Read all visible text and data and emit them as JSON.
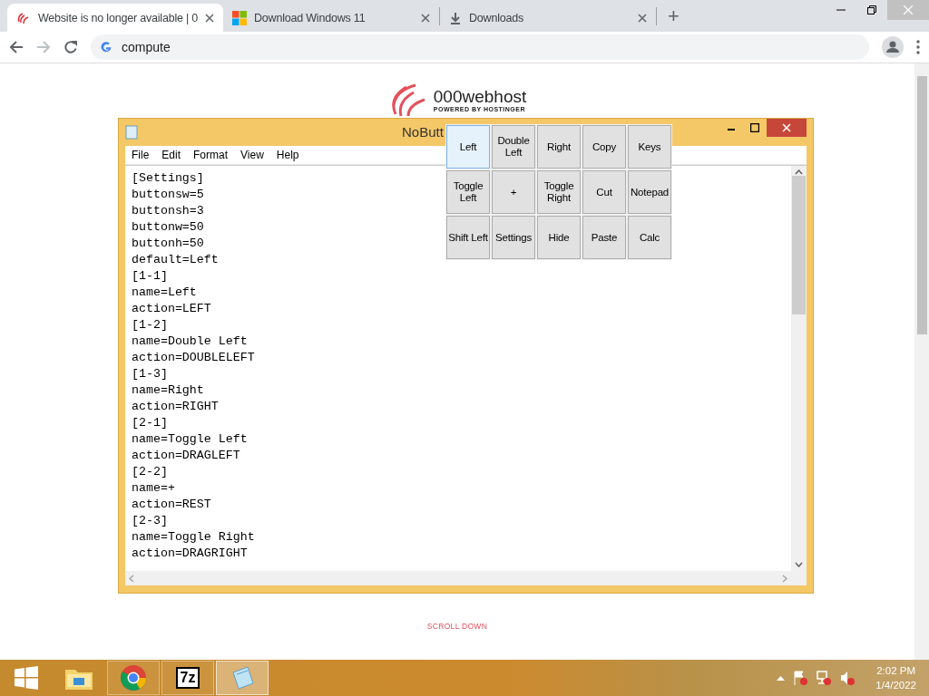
{
  "browser": {
    "tabs": [
      {
        "kind": "swirl",
        "title": "Website is no longer available | 0",
        "selected": true
      },
      {
        "kind": "windows",
        "title": "Download Windows 11",
        "selected": false
      },
      {
        "kind": "download",
        "title": "Downloads",
        "selected": false
      }
    ],
    "new_tab": "+",
    "address": "compute"
  },
  "page": {
    "logo_name": "000webhost",
    "logo_tagline": "POWERED BY HOSTINGER",
    "scroll_hint": "SCROLL DOWN"
  },
  "notepad": {
    "title": "NoButt",
    "menu": [
      "File",
      "Edit",
      "Format",
      "View",
      "Help"
    ],
    "lines": [
      "[Settings]",
      "buttonsw=5",
      "buttonsh=3",
      "buttonw=50",
      "buttonh=50",
      "default=Left",
      "[1-1]",
      "name=Left",
      "action=LEFT",
      "[1-2]",
      "name=Double Left",
      "action=DOUBLELEFT",
      "[1-3]",
      "name=Right",
      "action=RIGHT",
      "[2-1]",
      "name=Toggle Left",
      "action=DRAGLEFT",
      "[2-2]",
      "name=+",
      "action=REST",
      "[2-3]",
      "name=Toggle Right",
      "action=DRAGRIGHT"
    ]
  },
  "button_grid": {
    "buttons": [
      {
        "label": "Left",
        "selected": true
      },
      {
        "label": "Double Left",
        "selected": false
      },
      {
        "label": "Right",
        "selected": false
      },
      {
        "label": "Copy",
        "selected": false
      },
      {
        "label": "Keys",
        "selected": false
      },
      {
        "label": "Toggle Left",
        "selected": false
      },
      {
        "label": "+",
        "selected": false
      },
      {
        "label": "Toggle Right",
        "selected": false
      },
      {
        "label": "Cut",
        "selected": false
      },
      {
        "label": "Notepad",
        "selected": false
      },
      {
        "label": "Shift Left",
        "selected": false
      },
      {
        "label": "Settings",
        "selected": false
      },
      {
        "label": "Hide",
        "selected": false
      },
      {
        "label": "Paste",
        "selected": false
      },
      {
        "label": "Calc",
        "selected": false
      }
    ]
  },
  "taskbar": {
    "apps": [
      {
        "kind": "explorer",
        "selected": false
      },
      {
        "kind": "chrome",
        "selected": false
      },
      {
        "kind": "sevenzip",
        "selected": false
      },
      {
        "kind": "notepad",
        "selected": true
      }
    ],
    "sevenzip_label": "7z",
    "time": "2:02 PM",
    "date": "1/4/2022"
  }
}
